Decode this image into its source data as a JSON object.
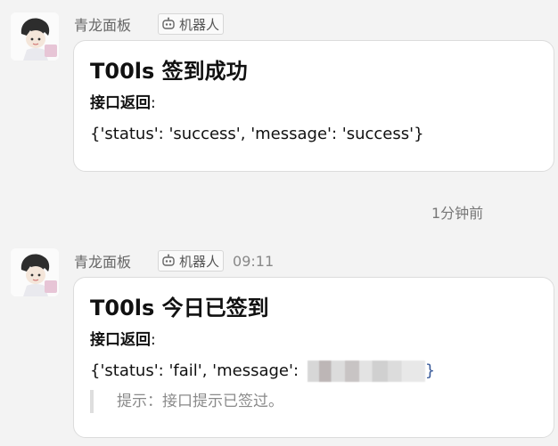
{
  "messages": [
    {
      "sender": "青龙面板",
      "bot_label": "机器人",
      "time": "",
      "title": "T00ls 签到成功",
      "field_label": "接口返回",
      "colon": ":",
      "response_text": "{'status': 'success', 'message': 'success'}",
      "hint": ""
    },
    {
      "sender": "青龙面板",
      "bot_label": "机器人",
      "time": "09:11",
      "title": "T00ls 今日已签到",
      "field_label": "接口返回",
      "colon": ":",
      "response_prefix": "{'status': 'fail', 'message': ",
      "response_suffix": "}",
      "hint": "提示：接口提示已签过。"
    }
  ],
  "separator_time": "1分钟前",
  "icons": {
    "avatar": "cartoon-avatar-icon",
    "bot": "robot-icon"
  }
}
